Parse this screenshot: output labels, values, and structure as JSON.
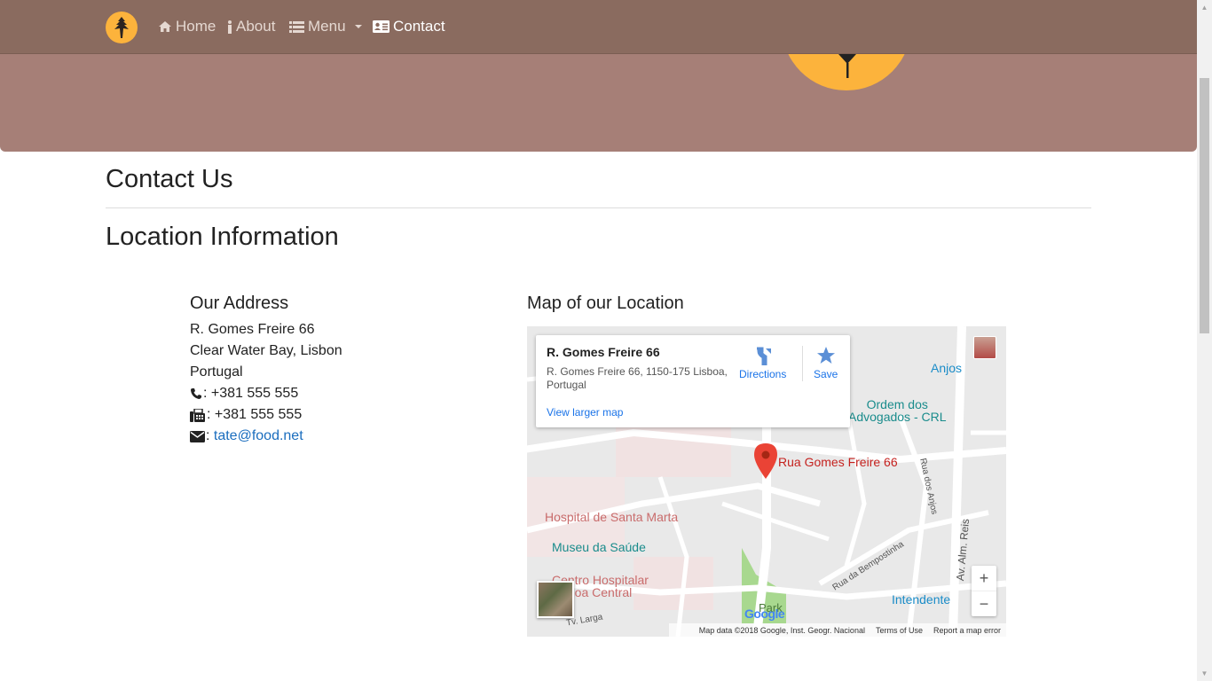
{
  "nav": {
    "items": [
      {
        "label": "Home",
        "icon": "home-icon"
      },
      {
        "label": "About",
        "icon": "info-icon"
      },
      {
        "label": "Menu",
        "icon": "list-icon"
      },
      {
        "label": "Contact",
        "icon": "address-card-icon"
      }
    ]
  },
  "page": {
    "title": "Contact Us",
    "subtitle": "Location Information"
  },
  "address": {
    "heading": "Our Address",
    "line1": "R. Gomes Freire 66",
    "line2": "Clear Water Bay, Lisbon",
    "line3": "Portugal",
    "phone": ": +381 555 555",
    "fax": ": +381 555 555",
    "email_sep": ": ",
    "email": "tate@food.net"
  },
  "map": {
    "heading": "Map of our Location",
    "card": {
      "title": "R. Gomes Freire 66",
      "address": "R. Gomes Freire 66, 1150-175 Lisboa, Portugal",
      "directions": "Directions",
      "save": "Save",
      "larger": "View larger map"
    },
    "labels": {
      "pin": "Rua Gomes Freire 66",
      "hospital": "Hospital de Santa Marta",
      "museu": "Museu da Saúde",
      "centro1": "Centro Hospitalar",
      "centro2": "Lisboa Central",
      "anjos": "Anjos",
      "ordem1": "Ordem dos",
      "ordem2": "Advogados - CRL",
      "intendente": "Intendente",
      "park": "Park",
      "street1": "Rua dos Anjos",
      "street2": "Av. Alm. Reis",
      "street3": "Rua da Bempostinha",
      "street4": "Tv. Larga"
    },
    "footer": {
      "data": "Map data ©2018 Google, Inst. Geogr. Nacional",
      "terms": "Terms of Use",
      "report": "Report a map error"
    },
    "zoom_in": "+",
    "zoom_out": "−",
    "google": "Google"
  },
  "colors": {
    "navbar": "#8a6b5f",
    "hero": "#a67f77",
    "accent": "#fcb33c",
    "link": "#1a6dbe"
  }
}
